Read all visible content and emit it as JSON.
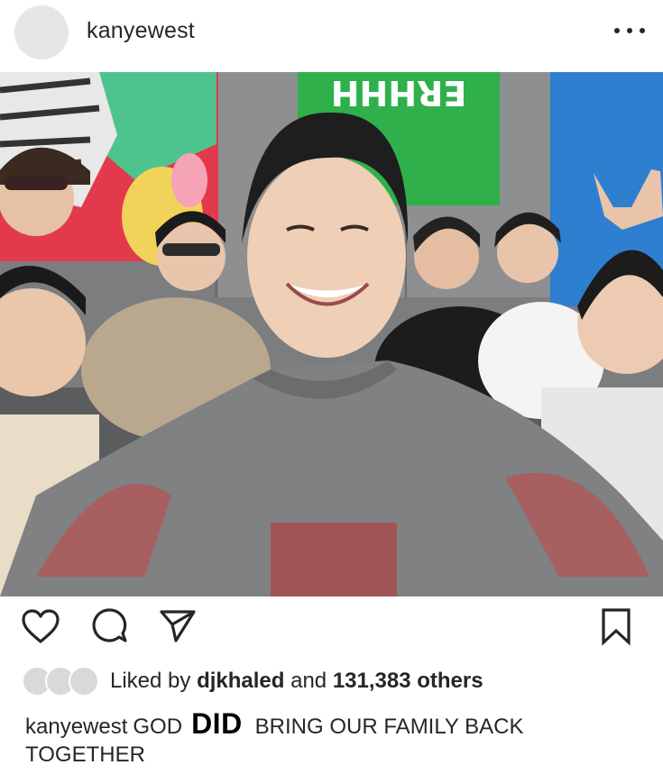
{
  "post": {
    "username": "kanyewest",
    "more_icon": "ellipsis-icon"
  },
  "photo": {
    "banner_text": "ERHHH"
  },
  "actions": {
    "like_icon": "heart-icon",
    "comment_icon": "comment-icon",
    "share_icon": "paper-plane-icon",
    "save_icon": "bookmark-icon"
  },
  "likes": {
    "prefix": "Liked by",
    "user": "djkhaled",
    "middle": "and",
    "count": "131,383 others"
  },
  "caption": {
    "username": "kanyewest",
    "part1": "GOD",
    "emphasis": "DID",
    "part2": "BRING OUR FAMILY BACK TOGETHER"
  }
}
